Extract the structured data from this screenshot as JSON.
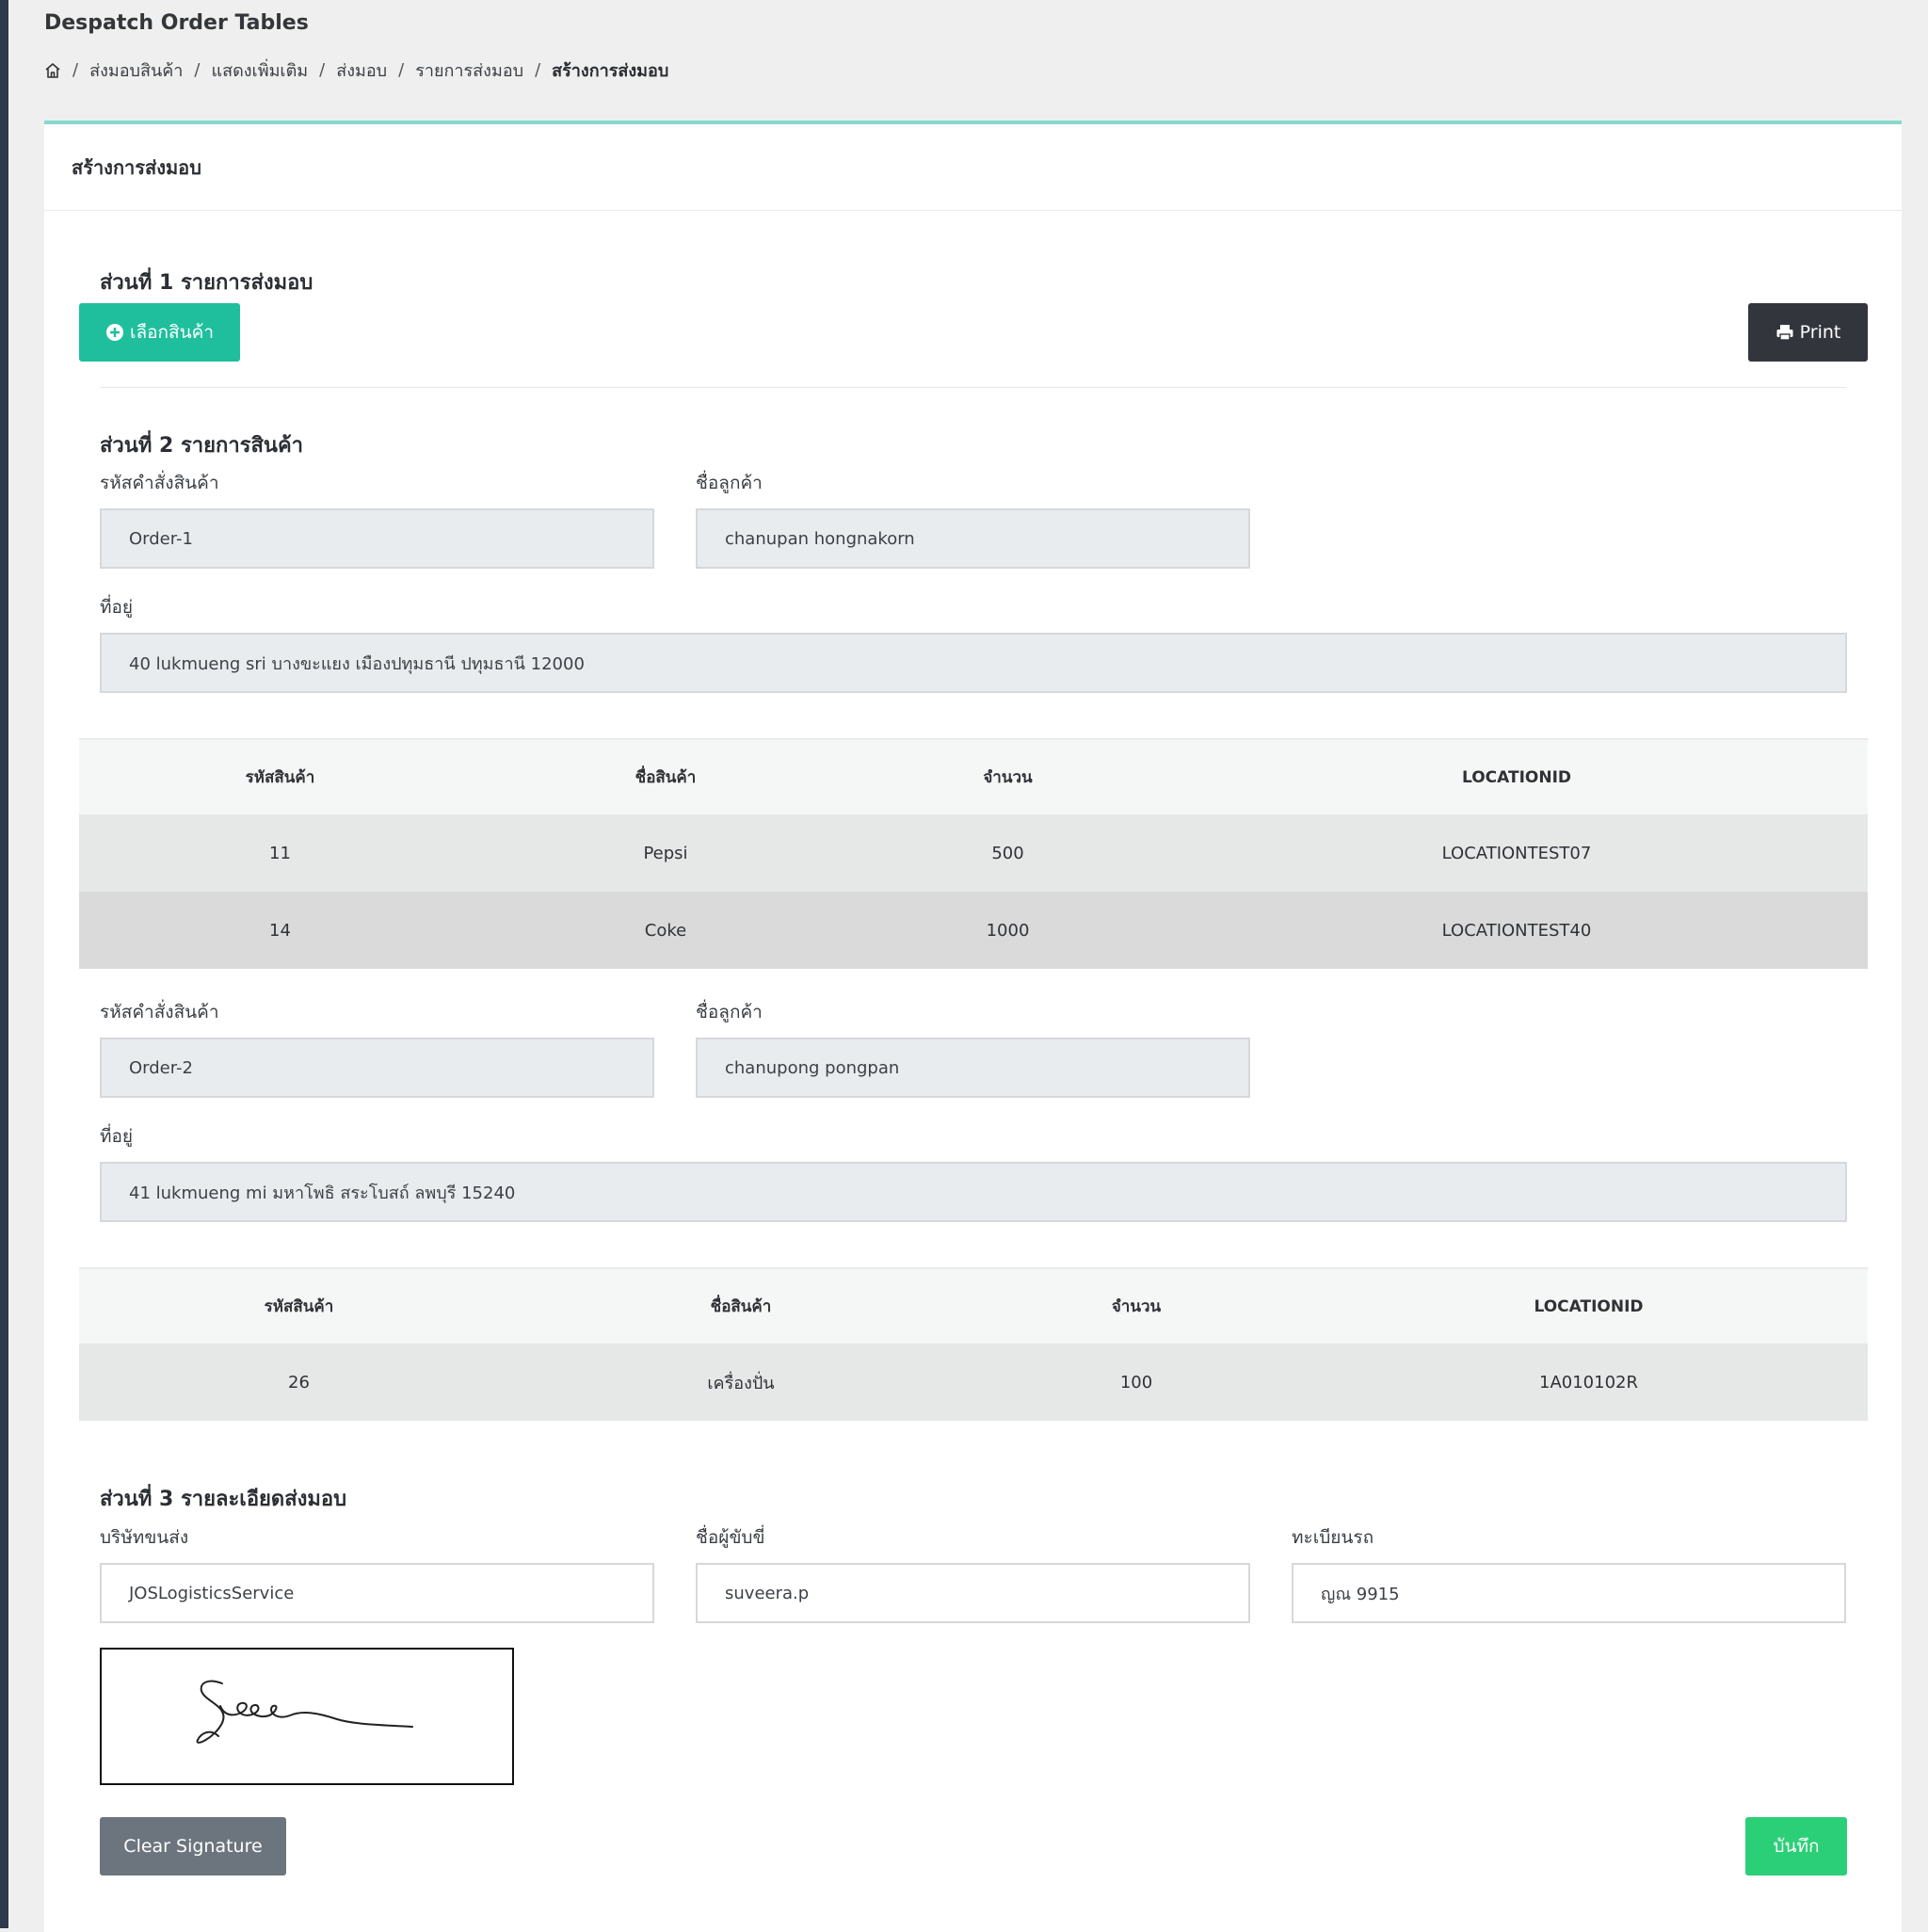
{
  "page": {
    "title": "Despatch Order Tables",
    "breadcrumb": [
      "ส่งมอบสินค้า",
      "แสดงเพิ่มเติม",
      "ส่งมอบ",
      "รายการส่งมอบ",
      "สร้างการส่งมอบ"
    ]
  },
  "card": {
    "title": "สร้างการส่งมอบ"
  },
  "section1": {
    "title": "ส่วนที่ 1 รายการส่งมอบ",
    "select_button": "เลือกสินค้า",
    "print_button": "Print"
  },
  "section2": {
    "title": "ส่วนที่ 2 รายการสินค้า",
    "orders": [
      {
        "order_label": "รหัสคำสั่งสินค้า",
        "order_value": "Order-1",
        "customer_label": "ชื่อลูกค้า",
        "customer_value": "chanupan hongnakorn",
        "address_label": "ที่อยู่",
        "address_value": "40 lukmueng sri บางขะแยง เมืองปทุมธานี ปทุมธานี 12000",
        "columns": [
          "รหัสสินค้า",
          "ชื่อสินค้า",
          "จำนวน",
          "LOCATIONID"
        ],
        "rows": [
          [
            "11",
            "Pepsi",
            "500",
            "LOCATIONTEST07"
          ],
          [
            "14",
            "Coke",
            "1000",
            "LOCATIONTEST40"
          ]
        ]
      },
      {
        "order_label": "รหัสคำสั่งสินค้า",
        "order_value": "Order-2",
        "customer_label": "ชื่อลูกค้า",
        "customer_value": "chanupong pongpan",
        "address_label": "ที่อยู่",
        "address_value": "41 lukmueng mi มหาโพธิ สระโบสถ์ ลพบุรี 15240",
        "columns": [
          "รหัสสินค้า",
          "ชื่อสินค้า",
          "จำนวน",
          "LOCATIONID"
        ],
        "rows": [
          [
            "26",
            "เครื่องปั่น",
            "100",
            "1A010102R"
          ]
        ]
      }
    ]
  },
  "section3": {
    "title": "ส่วนที่ 3 รายละเอียดส่งมอบ",
    "company_label": "บริษัทขนส่ง",
    "company_value": "JOSLogisticsService",
    "driver_label": "ชื่อผู้ขับขี่",
    "driver_value": "suveera.p",
    "plate_label": "ทะเบียนรถ",
    "plate_value": "ญณ 9915",
    "clear_button": "Clear Signature",
    "save_button": "บันทึก"
  },
  "icons": {
    "home": "home-icon",
    "add": "plus-circle-icon",
    "print": "printer-icon"
  },
  "colors": {
    "accent": "#88d8cc",
    "select_button": "#1fbf9d",
    "print_button": "#32363c",
    "clear_button": "#6c757d",
    "save_button": "#2bcf77"
  }
}
